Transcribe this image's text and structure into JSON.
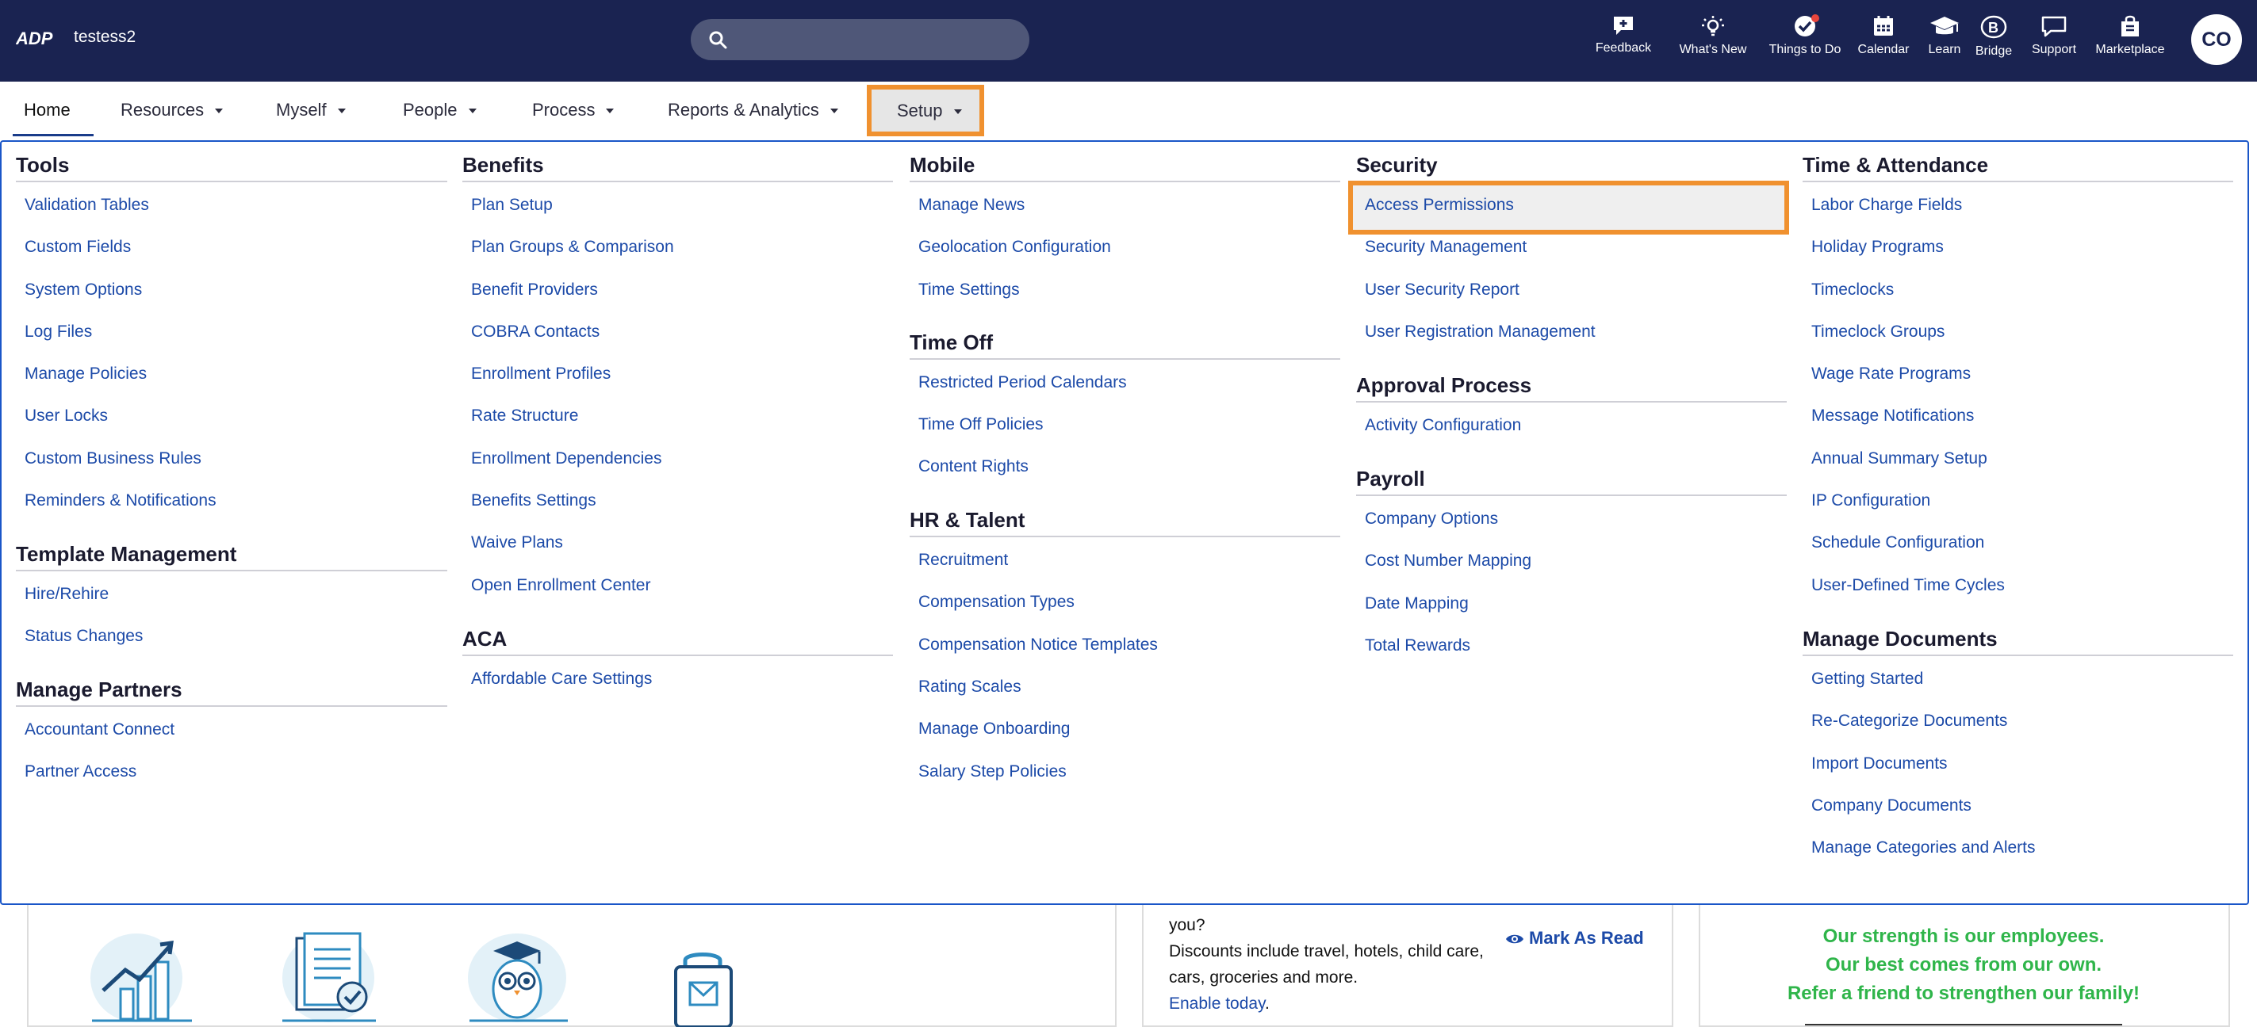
{
  "header": {
    "account_name": "testess2",
    "search": {
      "placeholder": ""
    },
    "icons": [
      {
        "name": "feedback-icon",
        "label": "Feedback"
      },
      {
        "name": "whats-new-icon",
        "label": "What's New"
      },
      {
        "name": "things-to-do-icon",
        "label": "Things to Do"
      },
      {
        "name": "calendar-icon",
        "label": "Calendar"
      },
      {
        "name": "learn-icon",
        "label": "Learn"
      },
      {
        "name": "bridge-icon",
        "label": "Bridge"
      },
      {
        "name": "support-icon",
        "label": "Support"
      },
      {
        "name": "marketplace-icon",
        "label": "Marketplace"
      }
    ],
    "avatar_initials": "CO"
  },
  "nav": {
    "items": [
      {
        "label": "Home"
      },
      {
        "label": "Resources"
      },
      {
        "label": "Myself"
      },
      {
        "label": "People"
      },
      {
        "label": "Process"
      },
      {
        "label": "Reports & Analytics"
      },
      {
        "label": "Setup"
      }
    ]
  },
  "menu": {
    "tools": {
      "title": "Tools",
      "links": [
        "Validation Tables",
        "Custom Fields",
        "System Options",
        "Log Files",
        "Manage Policies",
        "User Locks",
        "Custom Business Rules",
        "Reminders & Notifications"
      ]
    },
    "template_management": {
      "title": "Template Management",
      "links": [
        "Hire/Rehire",
        "Status Changes"
      ]
    },
    "manage_partners": {
      "title": "Manage Partners",
      "links": [
        "Accountant Connect",
        "Partner Access"
      ]
    },
    "benefits": {
      "title": "Benefits",
      "links": [
        "Plan Setup",
        "Plan Groups & Comparison",
        "Benefit Providers",
        "COBRA Contacts",
        "Enrollment Profiles",
        "Rate Structure",
        "Enrollment Dependencies",
        "Benefits Settings",
        "Waive Plans",
        "Open Enrollment Center"
      ]
    },
    "aca": {
      "title": "ACA",
      "links": [
        "Affordable Care Settings"
      ]
    },
    "mobile": {
      "title": "Mobile",
      "links": [
        "Manage News",
        "Geolocation Configuration",
        "Time Settings"
      ]
    },
    "time_off": {
      "title": "Time Off",
      "links": [
        "Restricted Period Calendars",
        "Time Off Policies",
        "Content Rights"
      ]
    },
    "hr_talent": {
      "title": "HR & Talent",
      "links": [
        "Recruitment",
        "Compensation Types",
        "Compensation Notice Templates",
        "Rating Scales",
        "Manage Onboarding",
        "Salary Step Policies"
      ]
    },
    "security": {
      "title": "Security",
      "links": [
        "Access Permissions",
        "Security Management",
        "User Security Report",
        "User Registration Management"
      ]
    },
    "approval_process": {
      "title": "Approval Process",
      "links": [
        "Activity Configuration"
      ]
    },
    "payroll": {
      "title": "Payroll",
      "links": [
        "Company Options",
        "Cost Number Mapping",
        "Date Mapping",
        "Total Rewards"
      ]
    },
    "time_attendance": {
      "title": "Time & Attendance",
      "links": [
        "Labor Charge Fields",
        "Holiday Programs",
        "Timeclocks",
        "Timeclock Groups",
        "Wage Rate Programs",
        "Message Notifications",
        "Annual Summary Setup",
        "IP Configuration",
        "Schedule Configuration",
        "User-Defined Time Cycles"
      ]
    },
    "manage_documents": {
      "title": "Manage Documents",
      "links": [
        "Getting Started",
        "Re-Categorize Documents",
        "Import Documents",
        "Company Documents",
        "Manage Categories and Alerts"
      ]
    }
  },
  "bottom": {
    "promo_line1": "you?",
    "promo_line2": "Discounts include travel, hotels, child care,",
    "promo_line3": "cars, groceries and more.",
    "enable_link": "Enable today",
    "enable_period": ".",
    "mark_as_read": "Mark As Read",
    "referral_line1": "Our strength is our employees.",
    "referral_line2": "Our best comes from our own.",
    "referral_line3": "Refer a friend to strengthen our family!"
  },
  "colors": {
    "header_bg": "#1a2351",
    "link": "#1c4aa8",
    "highlight": "#f0912f",
    "panel_border": "#1a56c8",
    "referral_text": "#2fb54a"
  }
}
